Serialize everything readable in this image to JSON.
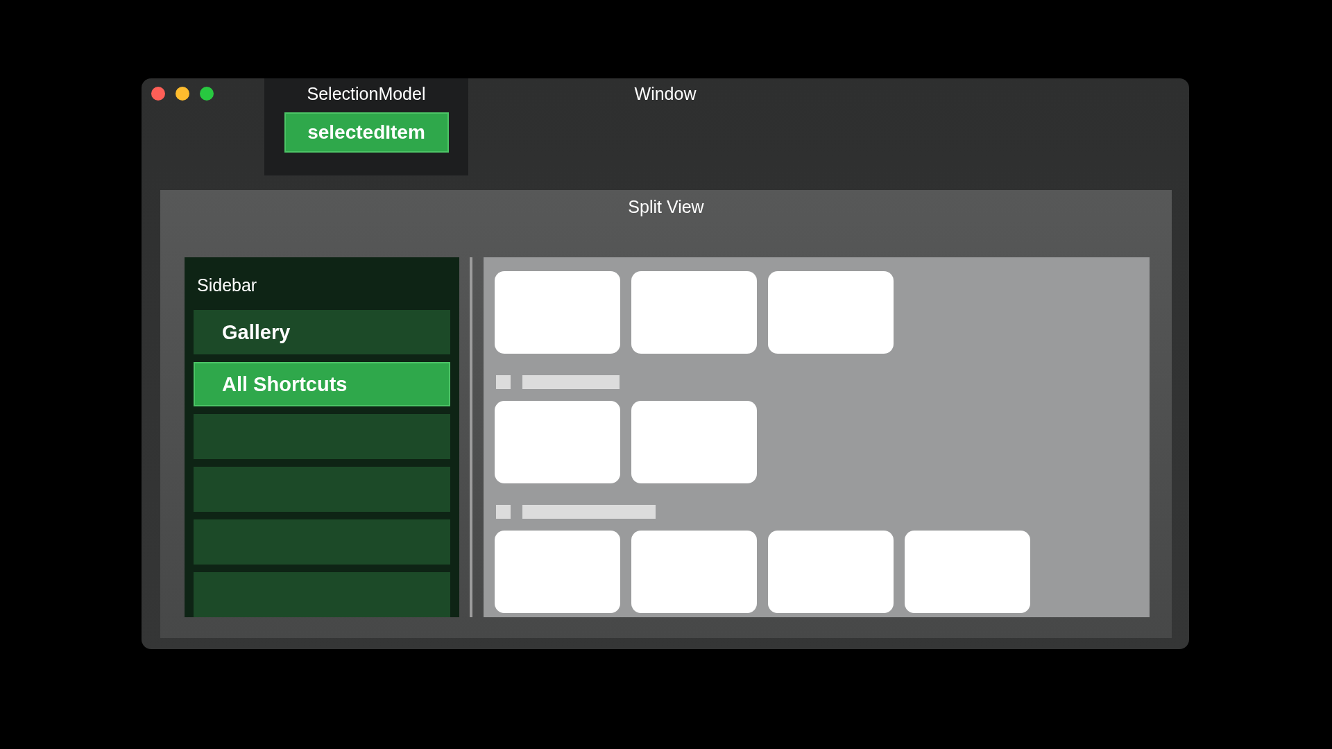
{
  "window": {
    "title": "Window"
  },
  "selection_model": {
    "title": "SelectionModel",
    "button": "selectedItem"
  },
  "split_view": {
    "title": "Split View",
    "sidebar": {
      "title": "Sidebar",
      "items": [
        {
          "label": "Gallery",
          "selected": false
        },
        {
          "label": "All Shortcuts",
          "selected": true
        }
      ]
    }
  }
}
